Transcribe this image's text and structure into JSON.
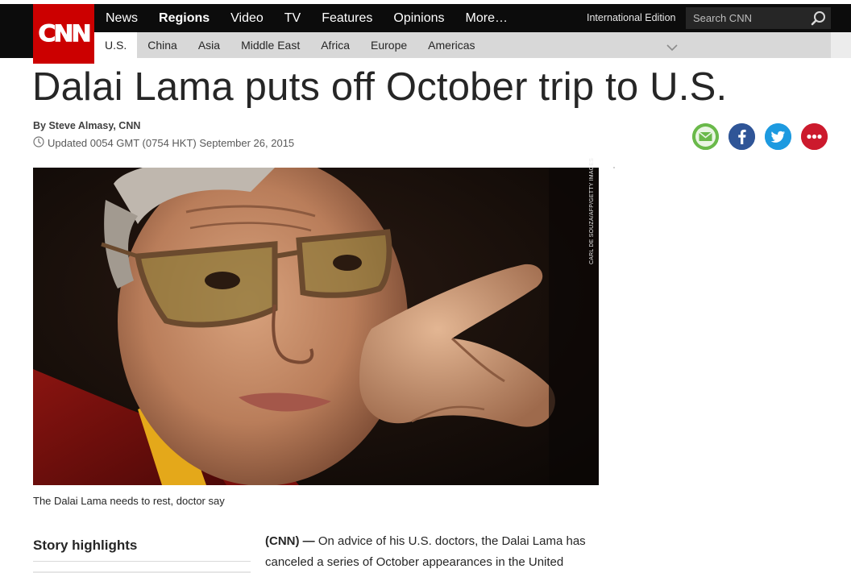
{
  "brand": {
    "logo_text": "CNN",
    "logo_color": "#cc0000"
  },
  "header": {
    "main_nav": [
      "News",
      "Regions",
      "Video",
      "TV",
      "Features",
      "Opinions",
      "More…"
    ],
    "active_main": "Regions",
    "edition": "International Edition",
    "search_placeholder": "Search CNN",
    "search_icon": "search-icon",
    "sub_nav": [
      "U.S.",
      "China",
      "Asia",
      "Middle East",
      "Africa",
      "Europe",
      "Americas"
    ],
    "active_sub": "U.S.",
    "expand_icon": "chevron-down-icon"
  },
  "article": {
    "headline": "Dalai Lama puts off October trip to U.S.",
    "byline": "By Steve Almasy, CNN",
    "updated": "Updated 0054 GMT (0754 HKT) September 26, 2015",
    "clock_icon": "clock-icon",
    "photo_credit": "CARL DE SOUZA/AFP/GETTY IMAGES",
    "caption": "The Dalai Lama needs to rest, doctor say",
    "highlights_title": "Story highlights",
    "dateline": "(CNN)",
    "dash": " — ",
    "body": "On advice of his U.S. doctors, the Dalai Lama has canceled a series of October appearances in the United"
  },
  "share": [
    {
      "name": "email",
      "icon": "email-icon",
      "color": "#6ab94a"
    },
    {
      "name": "facebook",
      "icon": "facebook-icon",
      "color": "#2f5597"
    },
    {
      "name": "twitter",
      "icon": "twitter-icon",
      "color": "#1d9ae0"
    },
    {
      "name": "more",
      "icon": "more-icon",
      "color": "#cc1a2d"
    }
  ]
}
